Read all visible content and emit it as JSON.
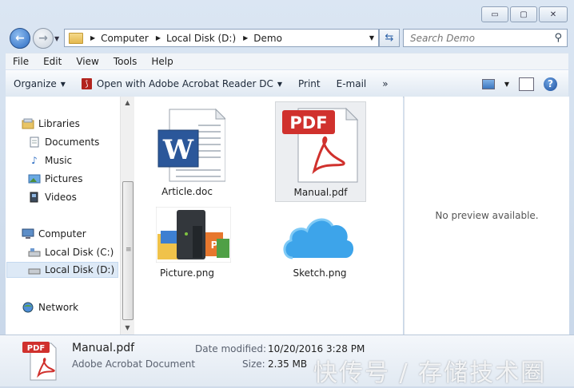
{
  "window": {
    "caption": {
      "minimize": "▭",
      "maximize": "▢",
      "close": "✕"
    }
  },
  "address": {
    "crumbs": [
      "Computer",
      "Local Disk (D:)",
      "Demo"
    ]
  },
  "search": {
    "placeholder": "Search Demo"
  },
  "menubar": {
    "items": [
      "File",
      "Edit",
      "View",
      "Tools",
      "Help"
    ]
  },
  "commandbar": {
    "organize": "Organize",
    "open_with": "Open with Adobe Acrobat Reader DC",
    "print": "Print",
    "email": "E-mail",
    "more": "»"
  },
  "navpane": {
    "libraries": "Libraries",
    "documents": "Documents",
    "music": "Music",
    "pictures": "Pictures",
    "videos": "Videos",
    "computer": "Computer",
    "disk_c": "Local Disk (C:)",
    "disk_d": "Local Disk (D:)",
    "network": "Network"
  },
  "files": [
    {
      "name": "Article.doc",
      "icon": "word-document-icon"
    },
    {
      "name": "Manual.pdf",
      "icon": "pdf-document-icon"
    },
    {
      "name": "Picture.png",
      "icon": "picture-thumbnail"
    },
    {
      "name": "Sketch.png",
      "icon": "cloud-thumbnail"
    }
  ],
  "icon_text": {
    "pdf": "PDF",
    "word": "W"
  },
  "preview": {
    "text": "No preview available."
  },
  "details": {
    "name": "Manual.pdf",
    "type": "Adobe Acrobat Document",
    "modified_label": "Date modified:",
    "modified_value": "10/20/2016 3:28 PM",
    "size_label": "Size:",
    "size_value": "2.35 MB"
  },
  "watermark": "快传号 / 存储技术圈",
  "colors": {
    "pdf_red": "#d0312d",
    "selection": "#eceef1",
    "accent_blue": "#2a6bc2"
  }
}
